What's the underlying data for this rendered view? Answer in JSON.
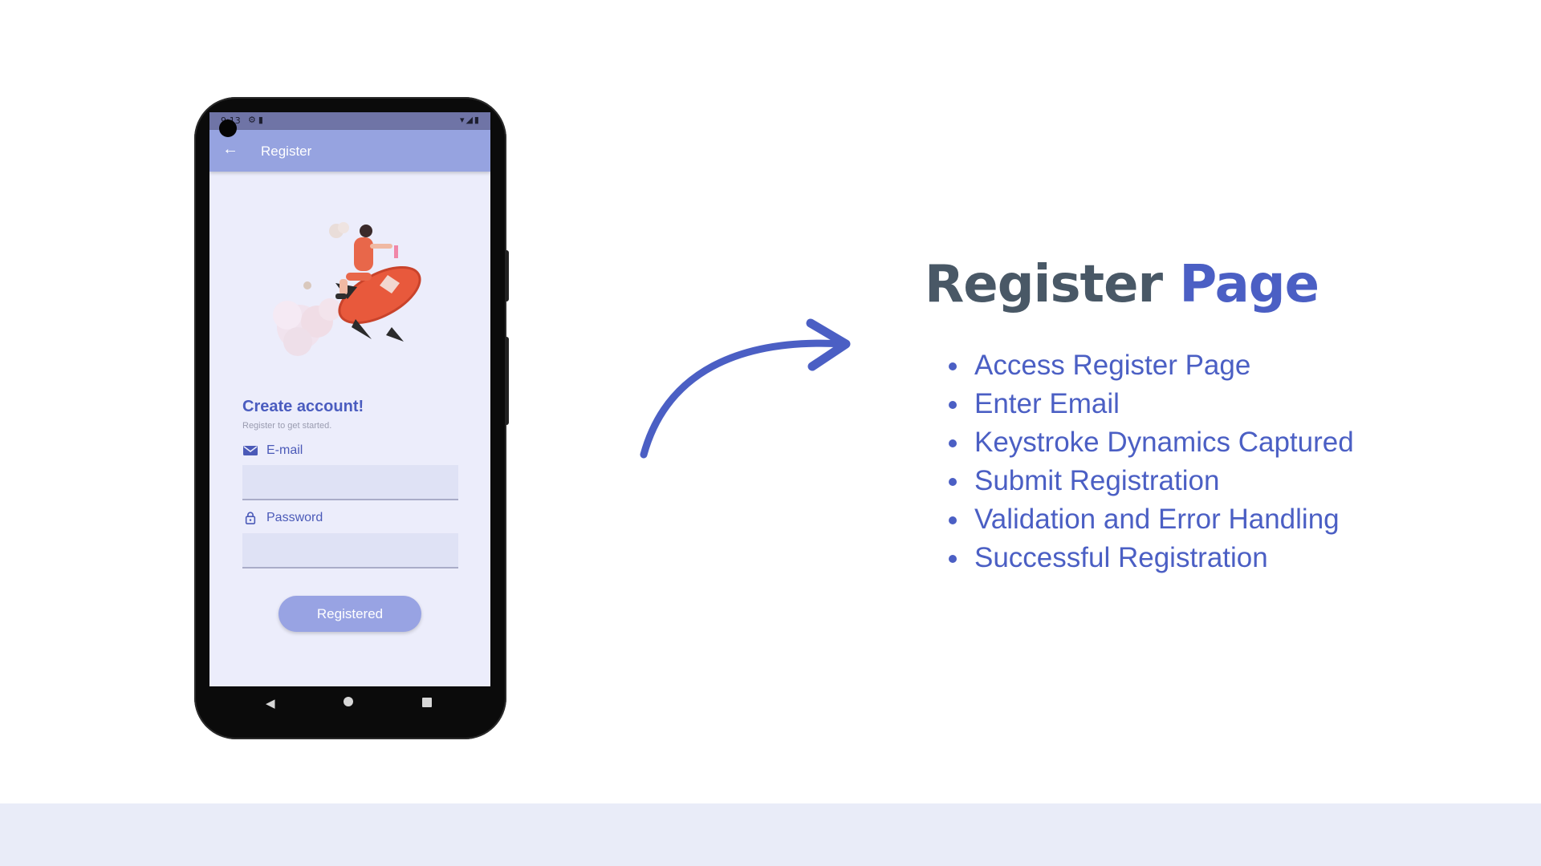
{
  "phone": {
    "status_time": "9:13",
    "appbar_title": "Register",
    "create_title": "Create account!",
    "create_subtitle": "Register to get started.",
    "email_label": "E-mail",
    "email_value": "",
    "password_label": "Password",
    "password_value": "",
    "register_button": "Registered",
    "icons": {
      "back": "arrow-left-icon",
      "email": "mail-icon",
      "password": "lock-icon",
      "nav_back": "triangle-back-icon",
      "nav_home": "circle-home-icon",
      "nav_recent": "square-recent-icon"
    },
    "colors": {
      "appbar": "#96a3e0",
      "screen_bg": "#ecedfb",
      "accent": "#4a5cbf",
      "button": "#98a3e3"
    }
  },
  "slide": {
    "heading_part1": "Register",
    "heading_part2": "Page",
    "bullets": [
      "Access Register Page",
      "Enter Email",
      "Keystroke Dynamics Captured",
      "Submit Registration",
      "Validation and Error Handling",
      "Successful Registration"
    ],
    "colors": {
      "heading_dark": "#495866",
      "accent_blue": "#4b5fc4",
      "footer_band": "#e9ecf8"
    }
  }
}
